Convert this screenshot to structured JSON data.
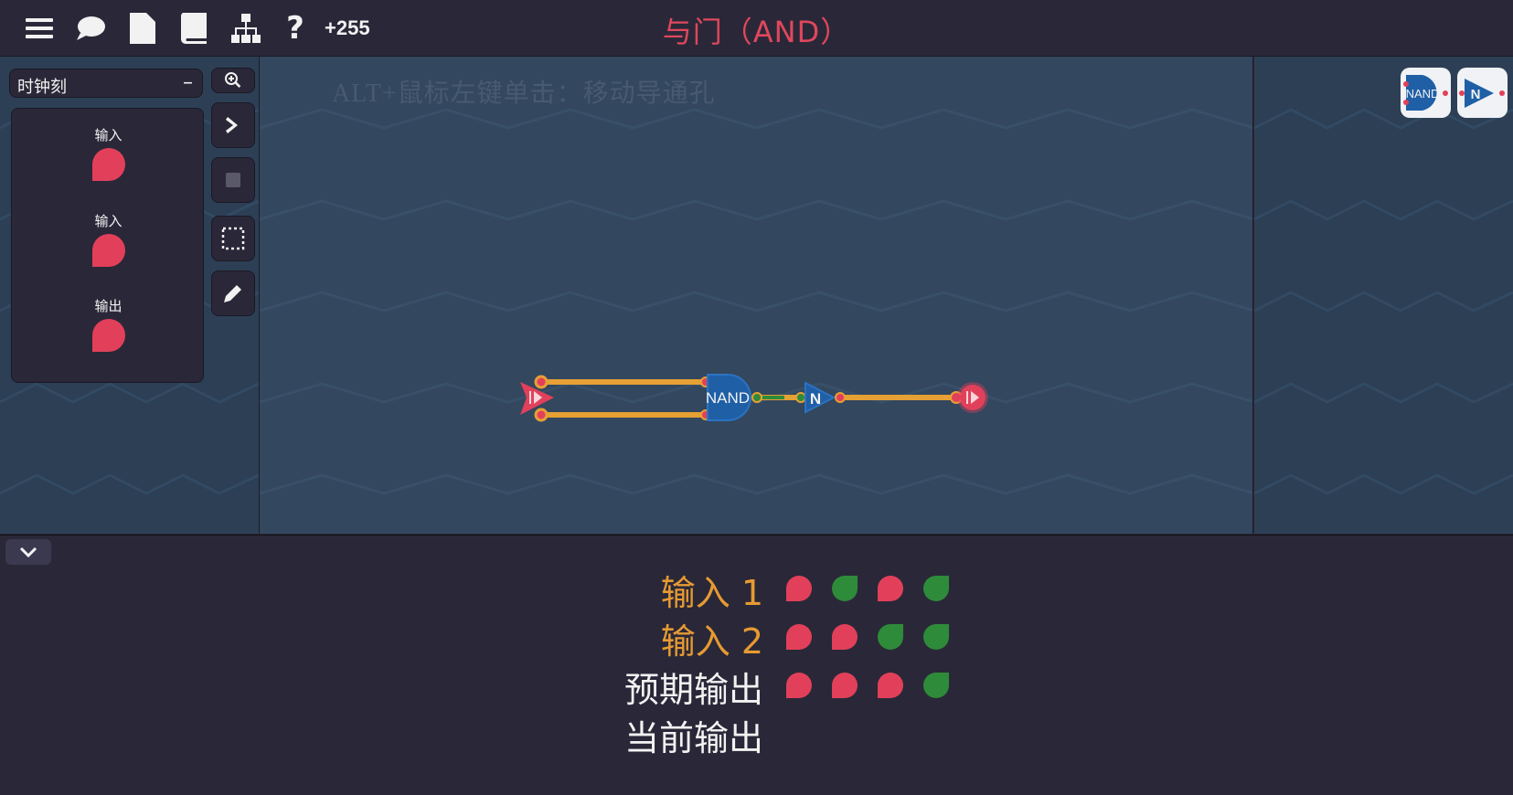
{
  "toolbar": {
    "credits": "+255",
    "level_title": "与门（AND）"
  },
  "left_panel": {
    "clock_select_value": "时钟刻",
    "clock_select_toggle": "–",
    "io_items": [
      {
        "label": "输入"
      },
      {
        "label": "输入"
      },
      {
        "label": "输出"
      }
    ]
  },
  "canvas": {
    "hint": "ALT+鼠标左键单击：移动导通孔",
    "nand_label": "NAND",
    "not_label": "N"
  },
  "palette": {
    "nand_label": "NAND",
    "not_label": "N"
  },
  "truth_table": {
    "rows": [
      {
        "label": "输入 1",
        "values": [
          "off",
          "on",
          "off",
          "on"
        ],
        "color": "#e79a32"
      },
      {
        "label": "输入 2",
        "values": [
          "off",
          "off",
          "on",
          "on"
        ],
        "color": "#e79a32"
      },
      {
        "label": "预期输出",
        "values": [
          "off",
          "off",
          "off",
          "on"
        ],
        "color": "#f2f2f2"
      },
      {
        "label": "当前输出",
        "values": [],
        "color": "#f2f2f2"
      }
    ]
  },
  "colors": {
    "on": "#2e8b3a",
    "off": "#e2405a",
    "wire": "#e6a034",
    "gate": "#1f5fa6"
  }
}
